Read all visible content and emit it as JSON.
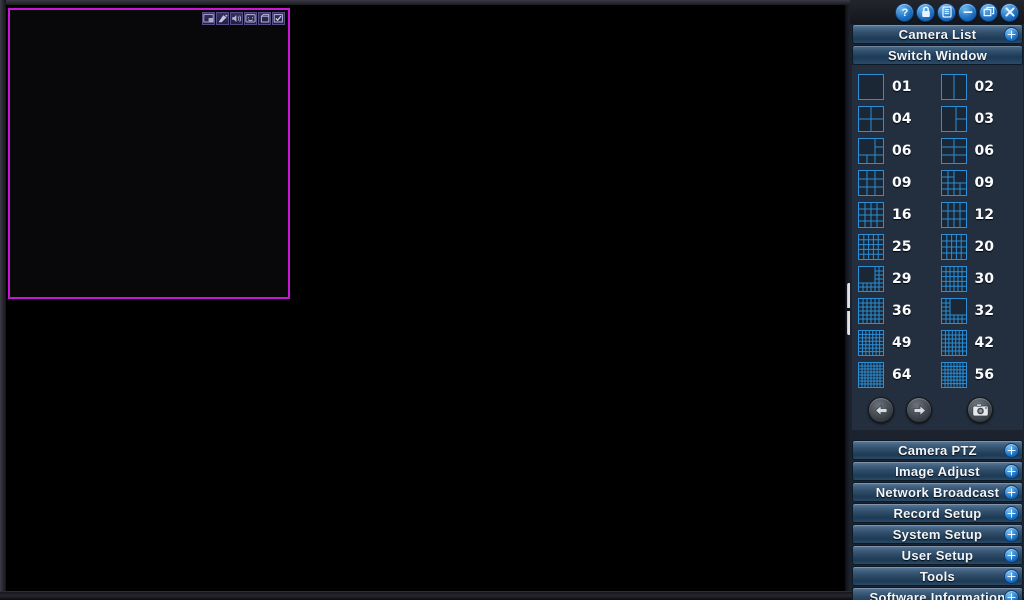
{
  "window": {
    "titlebar_buttons": [
      {
        "name": "help-button",
        "icon": "question-icon",
        "label": "?"
      },
      {
        "name": "lock-button",
        "icon": "lock-icon",
        "label": "Lock"
      },
      {
        "name": "log-button",
        "icon": "list-icon",
        "label": "Log"
      },
      {
        "name": "minimize-button",
        "icon": "minus-icon",
        "label": "Minimize"
      },
      {
        "name": "restore-button",
        "icon": "restore-icon",
        "label": "Restore"
      },
      {
        "name": "close-button",
        "icon": "close-icon",
        "label": "Close"
      }
    ]
  },
  "camera_panel": {
    "toolbar_buttons": [
      {
        "name": "pip-button",
        "icon": "pip-icon",
        "label": "Picture in Picture"
      },
      {
        "name": "ptz-button",
        "icon": "ptz-camera-icon",
        "label": "PTZ"
      },
      {
        "name": "audio-button",
        "icon": "speaker-icon",
        "label": "Audio"
      },
      {
        "name": "record-button",
        "icon": "record-monitor-icon",
        "label": "Record"
      },
      {
        "name": "snapshot-button",
        "icon": "snapshot-icon",
        "label": "Snapshot"
      },
      {
        "name": "select-button",
        "icon": "checkbox-icon",
        "label": "Select"
      }
    ],
    "selection_color": "#c915d6"
  },
  "sidebar": {
    "camera_list": {
      "label": "Camera List",
      "icon": "expand-plus-icon",
      "expanded": true
    },
    "switch_window": {
      "label": "Switch Window"
    },
    "layouts": [
      {
        "count": "01",
        "kind": "single"
      },
      {
        "count": "02",
        "kind": "cols2"
      },
      {
        "count": "04",
        "kind": "grid2"
      },
      {
        "count": "03",
        "kind": "big1right2"
      },
      {
        "count": "06",
        "kind": "big1plus5"
      },
      {
        "count": "06",
        "kind": "grid2x3"
      },
      {
        "count": "09",
        "kind": "grid3"
      },
      {
        "count": "09",
        "kind": "big1plus8"
      },
      {
        "count": "16",
        "kind": "grid4"
      },
      {
        "count": "12",
        "kind": "grid4x3"
      },
      {
        "count": "25",
        "kind": "grid5"
      },
      {
        "count": "20",
        "kind": "grid5x4"
      },
      {
        "count": "29",
        "kind": "big4plus_l"
      },
      {
        "count": "30",
        "kind": "grid6x5"
      },
      {
        "count": "36",
        "kind": "grid6"
      },
      {
        "count": "32",
        "kind": "big4plus_r"
      },
      {
        "count": "49",
        "kind": "grid7"
      },
      {
        "count": "42",
        "kind": "grid7x6"
      },
      {
        "count": "64",
        "kind": "grid8"
      },
      {
        "count": "56",
        "kind": "grid8x7"
      }
    ],
    "nav": {
      "prev_label": "Previous",
      "next_label": "Next",
      "snapshot_label": "Snapshot",
      "prev_icon": "arrow-left-icon",
      "next_icon": "arrow-right-icon",
      "snapshot_icon": "camera-icon"
    },
    "sections": [
      {
        "label": "Camera PTZ",
        "icon": "expand-plus-icon"
      },
      {
        "label": "Image Adjust",
        "icon": "expand-plus-icon"
      },
      {
        "label": "Network Broadcast",
        "icon": "expand-plus-icon"
      },
      {
        "label": "Record Setup",
        "icon": "expand-plus-icon"
      },
      {
        "label": "System Setup",
        "icon": "expand-plus-icon"
      },
      {
        "label": "User Setup",
        "icon": "expand-plus-icon"
      },
      {
        "label": "Tools",
        "icon": "expand-plus-icon"
      },
      {
        "label": "Software Information",
        "icon": "expand-plus-icon"
      }
    ]
  },
  "colors": {
    "accent_blue": "#2a8fd8",
    "sidebar_bg": "#232f3e",
    "header_blue": "#2c4a66",
    "selection_magenta": "#c915d6",
    "video_bg": "#000000"
  }
}
